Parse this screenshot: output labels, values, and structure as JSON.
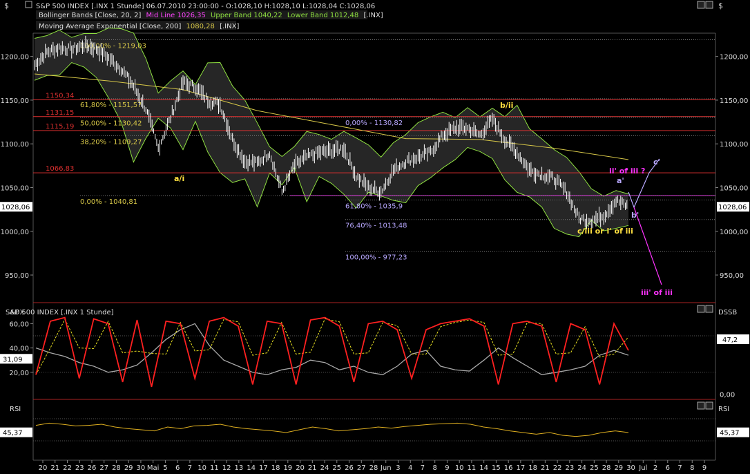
{
  "header": {
    "dollar_left": "$",
    "dollar_right": "$",
    "title": "S&P 500 INDEX [.INX  1 Stunde] 06.07.2010 23:00:00 - O:1028,10 H:1028,10 L:1028,04 C:1028,06",
    "legend_bb_prefix": "Bollinger Bands [Close, 20, 2]",
    "legend_bb_mid": "Mid Line 1026,35",
    "legend_bb_upper": "Upper Band 1040,22",
    "legend_bb_lower": "Lower Band 1012,48",
    "legend_bb_suffix": "[.INX]",
    "legend_ema_prefix": "Moving Average Exponential [Close, 200]",
    "legend_ema_value": "1080,28",
    "legend_ema_suffix": "[.INX]"
  },
  "colors": {
    "background": "#000000",
    "red_level": "#e03030",
    "fib_yellow": "#d8c848",
    "fib_lavender": "#b8a8ff",
    "magenta": "#ff33ff",
    "band": "#8fe040",
    "ema": "#d8c848",
    "price": "#ffffff",
    "adx": "#ff2020",
    "dss_grey": "#a8a8a8",
    "rsi": "#e0b020"
  },
  "chart_data": [
    {
      "type": "candlestick",
      "title": "S&P 500 INDEX [.INX  1 Stunde]",
      "y_ticks": [
        "1200,00",
        "1150,00",
        "1100,00",
        "1050,00",
        "1000,00",
        "950,00"
      ],
      "y_tick_values": [
        1200,
        1150,
        1100,
        1050,
        1000,
        950
      ],
      "ylim": [
        920,
        1225
      ],
      "last_price_label": "1028,06",
      "price_path": [
        [
          0,
          1190
        ],
        [
          1,
          1205
        ],
        [
          2,
          1210
        ],
        [
          3,
          1208
        ],
        [
          4,
          1213
        ],
        [
          5,
          1209
        ],
        [
          6,
          1198
        ],
        [
          7,
          1186
        ],
        [
          8,
          1166
        ],
        [
          9,
          1140
        ],
        [
          10,
          1095
        ],
        [
          11,
          1130
        ],
        [
          12,
          1170
        ],
        [
          13,
          1165
        ],
        [
          14,
          1150
        ],
        [
          15,
          1145
        ],
        [
          16,
          1105
        ],
        [
          17,
          1080
        ],
        [
          18,
          1078
        ],
        [
          19,
          1090
        ],
        [
          20,
          1045
        ],
        [
          21,
          1075
        ],
        [
          22,
          1085
        ],
        [
          23,
          1090
        ],
        [
          24,
          1092
        ],
        [
          25,
          1095
        ],
        [
          26,
          1063
        ],
        [
          27,
          1050
        ],
        [
          28,
          1045
        ],
        [
          29,
          1070
        ],
        [
          30,
          1080
        ],
        [
          31,
          1085
        ],
        [
          32,
          1090
        ],
        [
          33,
          1110
        ],
        [
          34,
          1118
        ],
        [
          35,
          1118
        ],
        [
          36,
          1110
        ],
        [
          37,
          1128
        ],
        [
          38,
          1105
        ],
        [
          39,
          1090
        ],
        [
          40,
          1070
        ],
        [
          41,
          1065
        ],
        [
          42,
          1060
        ],
        [
          43,
          1045
        ],
        [
          44,
          1015
        ],
        [
          45,
          1012
        ],
        [
          46,
          1018
        ],
        [
          47,
          1035
        ],
        [
          48,
          1028
        ]
      ],
      "ema_path": [
        [
          0,
          1180
        ],
        [
          6,
          1172
        ],
        [
          12,
          1162
        ],
        [
          18,
          1138
        ],
        [
          24,
          1122
        ],
        [
          30,
          1106
        ],
        [
          36,
          1105
        ],
        [
          42,
          1095
        ],
        [
          48,
          1082
        ]
      ],
      "horizontal_levels": [
        {
          "value": 1150.34,
          "label": "1150,34",
          "color": "red"
        },
        {
          "value": 1131.15,
          "label": "1131,15",
          "color": "red"
        },
        {
          "value": 1115.19,
          "label": "1115,19",
          "color": "red"
        },
        {
          "value": 1066.83,
          "label": "1066,83",
          "color": "red"
        },
        {
          "value": 1040.81,
          "label": "",
          "color": "magenta"
        }
      ],
      "fib_yellow": [
        {
          "value": 1219.03,
          "label": "100,00% - 1219,03"
        },
        {
          "value": 1151.57,
          "label": "61,80% - 1151,57"
        },
        {
          "value": 1130.42,
          "label": "50,00% - 1130,42"
        },
        {
          "value": 1109.27,
          "label": "38,20% - 1109,27"
        },
        {
          "value": 1040.81,
          "label": "0,00% - 1040,81"
        }
      ],
      "fib_lavender": [
        {
          "value": 1130.82,
          "label": "0,00% - 1130,82"
        },
        {
          "value": 1035.9,
          "label": "61,80% - 1035,9"
        },
        {
          "value": 1013.48,
          "label": "76,40% - 1013,48"
        },
        {
          "value": 977.23,
          "label": "100,00% - 977,23"
        }
      ],
      "annotations": [
        {
          "text": "a/i",
          "color": "yellow"
        },
        {
          "text": "b/ii",
          "color": "yellow"
        },
        {
          "text": "c/iii or i' of iii",
          "color": "yellow"
        },
        {
          "text": "ii' of iii ?",
          "color": "magenta"
        },
        {
          "text": "a'",
          "color": "lavender"
        },
        {
          "text": "b'",
          "color": "lavender"
        },
        {
          "text": "c'",
          "color": "lavender"
        },
        {
          "text": "iii' of iii",
          "color": "magenta"
        }
      ]
    },
    {
      "type": "line",
      "title": "ADX",
      "right_title": "DSSB",
      "y_ticks_left": [
        "60,00",
        "40,00",
        "20,00"
      ],
      "y_tick_values_left": [
        60,
        40,
        20
      ],
      "ylim": [
        0,
        75
      ],
      "last_label_left": "31,09",
      "last_label_right": "47,2",
      "right_tick": "0,00",
      "series": [
        {
          "name": "DSSB",
          "values": [
            18,
            62,
            65,
            15,
            64,
            60,
            12,
            63,
            8,
            62,
            60,
            15,
            62,
            65,
            58,
            10,
            62,
            60,
            10,
            63,
            65,
            58,
            12,
            60,
            62,
            55,
            15,
            55,
            60,
            62,
            64,
            58,
            10,
            60,
            62,
            58,
            12,
            60,
            55,
            10,
            60,
            38
          ]
        },
        {
          "name": "ADX",
          "values": [
            40,
            36,
            33,
            28,
            25,
            20,
            22,
            26,
            36,
            47,
            55,
            60,
            42,
            30,
            25,
            20,
            18,
            22,
            24,
            30,
            28,
            22,
            25,
            20,
            18,
            25,
            35,
            38,
            25,
            22,
            21,
            30,
            40,
            32,
            25,
            18,
            20,
            22,
            25,
            34,
            38,
            34
          ]
        }
      ]
    },
    {
      "type": "line",
      "title": "RSI",
      "right_title": "RSI",
      "ylim": [
        0,
        100
      ],
      "last_label_left": "45,37",
      "last_label_right": "45,37",
      "series": [
        {
          "name": "RSI",
          "values": [
            58,
            62,
            60,
            57,
            58,
            60,
            55,
            52,
            50,
            48,
            55,
            52,
            57,
            58,
            60,
            55,
            52,
            50,
            48,
            45,
            50,
            55,
            52,
            48,
            50,
            52,
            55,
            53,
            56,
            58,
            60,
            61,
            62,
            60,
            55,
            52,
            48,
            45,
            42,
            45,
            40,
            38,
            40,
            45,
            48,
            45
          ]
        }
      ]
    }
  ],
  "x_axis": {
    "labels": [
      "20",
      "21",
      "22",
      "23",
      "26",
      "27",
      "28",
      "29",
      "30",
      "Mai",
      "5",
      "6",
      "7",
      "10",
      "11",
      "12",
      "13",
      "14",
      "17",
      "18",
      "19",
      "20",
      "21",
      "24",
      "25",
      "26",
      "27",
      "28",
      "Jun",
      "3",
      "4",
      "7",
      "8",
      "9",
      "10",
      "11",
      "14",
      "15",
      "16",
      "17",
      "18",
      "21",
      "22",
      "23",
      "24",
      "25",
      "28",
      "29",
      "30",
      "Jul",
      "2",
      "6",
      "7",
      "8",
      "9"
    ]
  }
}
